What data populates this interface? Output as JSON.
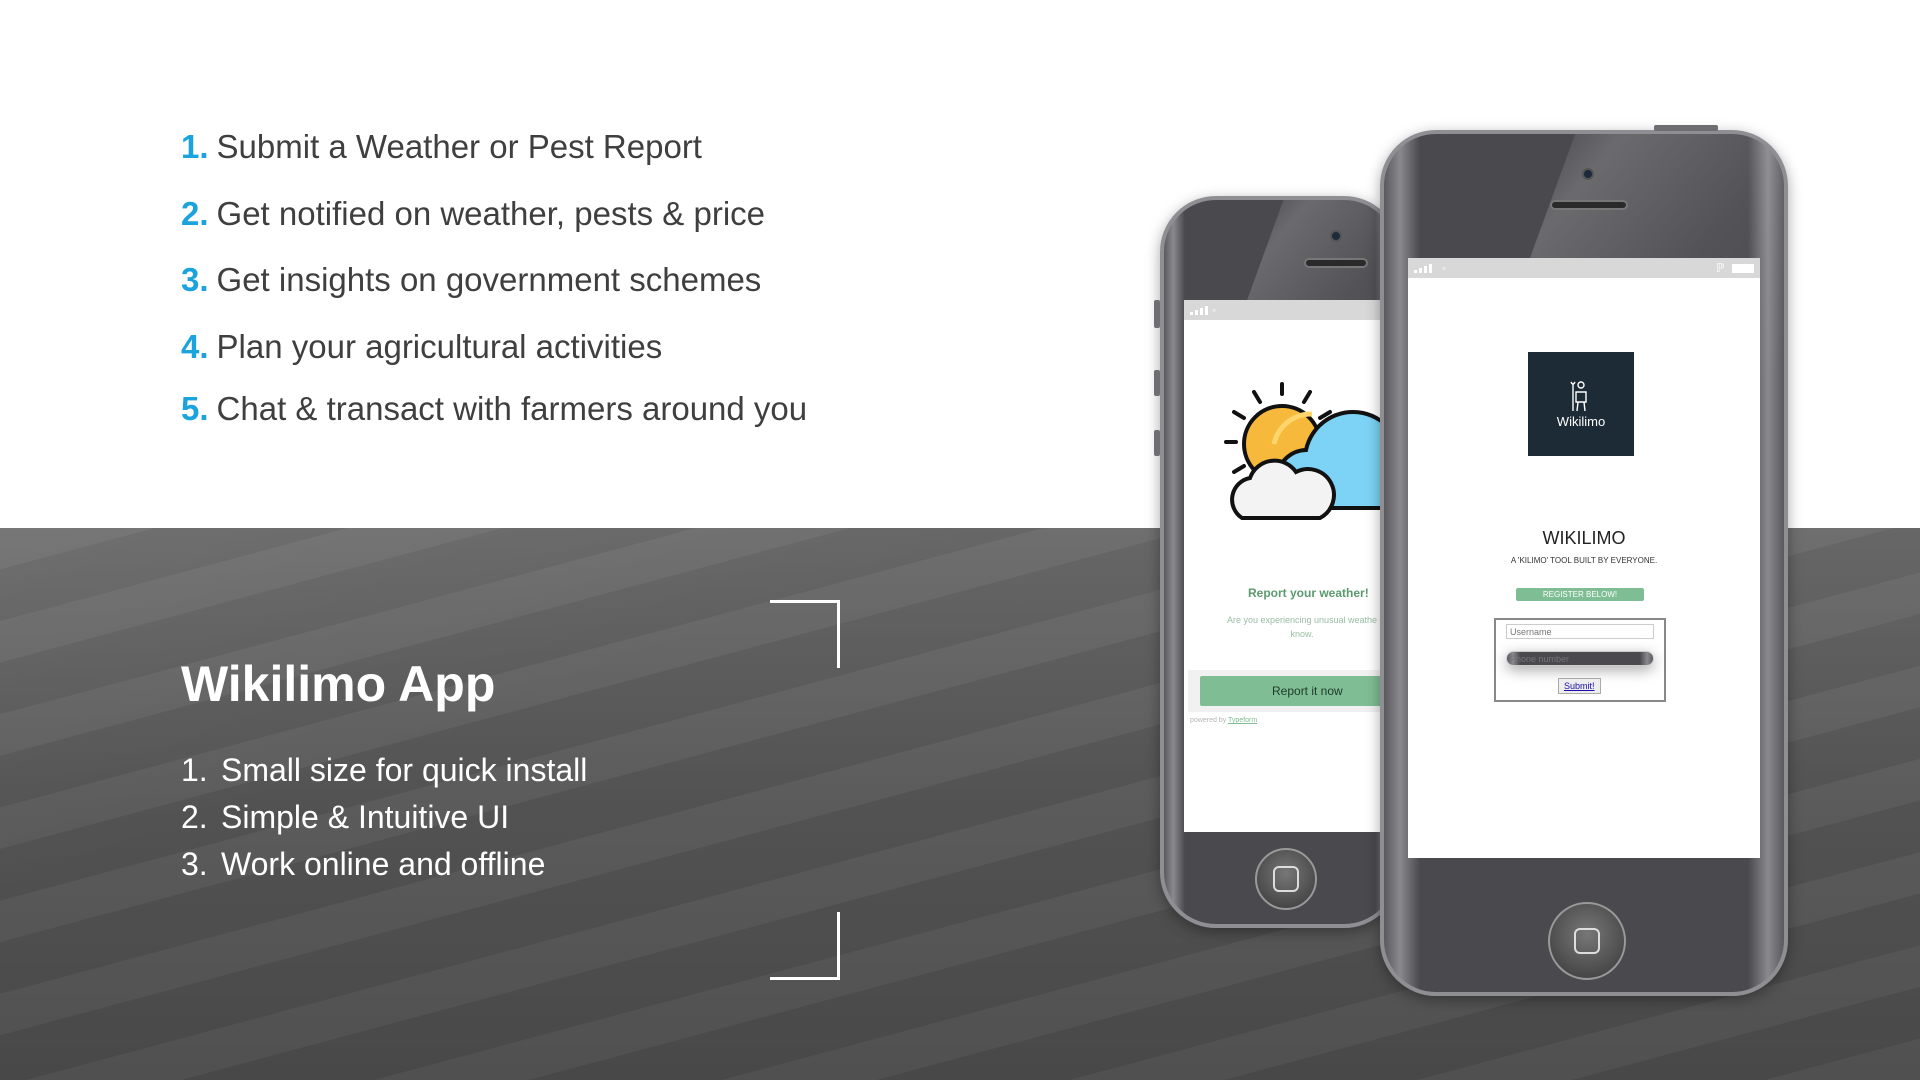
{
  "features": [
    {
      "num": "1.",
      "text": "Submit a Weather or Pest Report"
    },
    {
      "num": "2.",
      "text": "Get notified on weather, pests & price"
    },
    {
      "num": "3.",
      "text": "Get insights on government schemes"
    },
    {
      "num": "4.",
      "text": "Plan your agricultural activities"
    },
    {
      "num": "5.",
      "text": "Chat & transact with farmers around you"
    }
  ],
  "app_section": {
    "title": "Wikilimo App",
    "points": [
      {
        "num": "1.",
        "text": "Small size for quick install"
      },
      {
        "num": "2.",
        "text": "Simple & Intuitive UI"
      },
      {
        "num": "3.",
        "text": "Work online and offline"
      }
    ]
  },
  "back_phone": {
    "report_title": "Report your weather!",
    "report_subtitle_line1": "Are you experiencing unusual weathe",
    "report_subtitle_line2": "know.",
    "report_button": "Report it now",
    "powered_by": "powered by ",
    "powered_link": "Typeform"
  },
  "front_phone": {
    "logo_text": "Wikilimo",
    "app_name": "WIKILIMO",
    "tagline": "A 'KILIMO' TOOL BUILT BY EVERYONE.",
    "register_label": "REGISTER BELOW!",
    "username_placeholder": "Username",
    "phone_placeholder": "Phone number",
    "submit_label": "Submit!"
  },
  "colors": {
    "accent_number": "#1aa3dc",
    "typeform_green": "#7fbd94",
    "logo_bg": "#1c2b35"
  }
}
